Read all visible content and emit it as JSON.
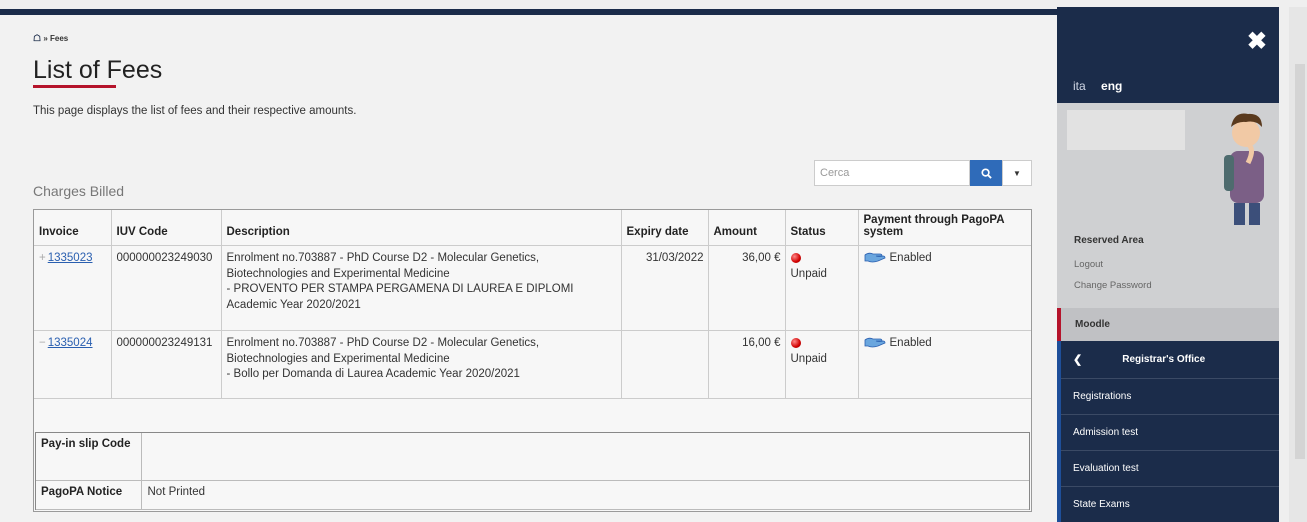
{
  "breadcrumb": {
    "current": "Fees"
  },
  "page": {
    "title": "List of Fees",
    "description": "This page displays the list of fees and their respective amounts."
  },
  "search": {
    "placeholder": "Cerca"
  },
  "section_title": "Charges Billed",
  "table": {
    "headers": {
      "invoice": "Invoice",
      "iuv": "IUV Code",
      "description": "Description",
      "expiry": "Expiry date",
      "amount": "Amount",
      "status": "Status",
      "payment": "Payment through PagoPA system"
    },
    "rows": [
      {
        "toggle": "+",
        "invoice": "1335023",
        "iuv": "000000023249030",
        "desc_line1": "Enrolment no.703887 - PhD Course D2 - Molecular Genetics,",
        "desc_line2": "Biotechnologies and Experimental Medicine",
        "desc_line3": "- PROVENTO PER STAMPA PERGAMENA DI LAUREA E DIPLOMI",
        "desc_line4": "Academic Year 2020/2021",
        "expiry": "31/03/2022",
        "amount": "36,00 €",
        "status": "Unpaid",
        "payment": "Enabled"
      },
      {
        "toggle": "−",
        "invoice": "1335024",
        "iuv": "000000023249131",
        "desc_line1": "Enrolment no.703887 - PhD Course D2 - Molecular Genetics,",
        "desc_line2": "Biotechnologies and Experimental Medicine",
        "desc_line3": "- Bollo per Domanda di Laurea Academic Year 2020/2021",
        "desc_line4": "",
        "expiry": "",
        "amount": "16,00 €",
        "status": "Unpaid",
        "payment": "Enabled"
      }
    ]
  },
  "slip": {
    "pay_in_label": "Pay-in slip Code",
    "pay_in_value": "",
    "pagopa_label": "PagoPA Notice",
    "pagopa_value": "Not Printed"
  },
  "sidebar": {
    "lang_ita": "ita",
    "lang_eng": "eng",
    "reserved_area": "Reserved Area",
    "logout": "Logout",
    "change_password": "Change Password",
    "moodle": "Moodle",
    "registrar": "Registrar's Office",
    "items": [
      "Registrations",
      "Admission test",
      "Evaluation test",
      "State Exams"
    ]
  },
  "colors": {
    "navy": "#1b2c4a",
    "accent_red": "#b5142b",
    "link_blue": "#2a5fb0",
    "search_blue": "#2f6bb9"
  }
}
